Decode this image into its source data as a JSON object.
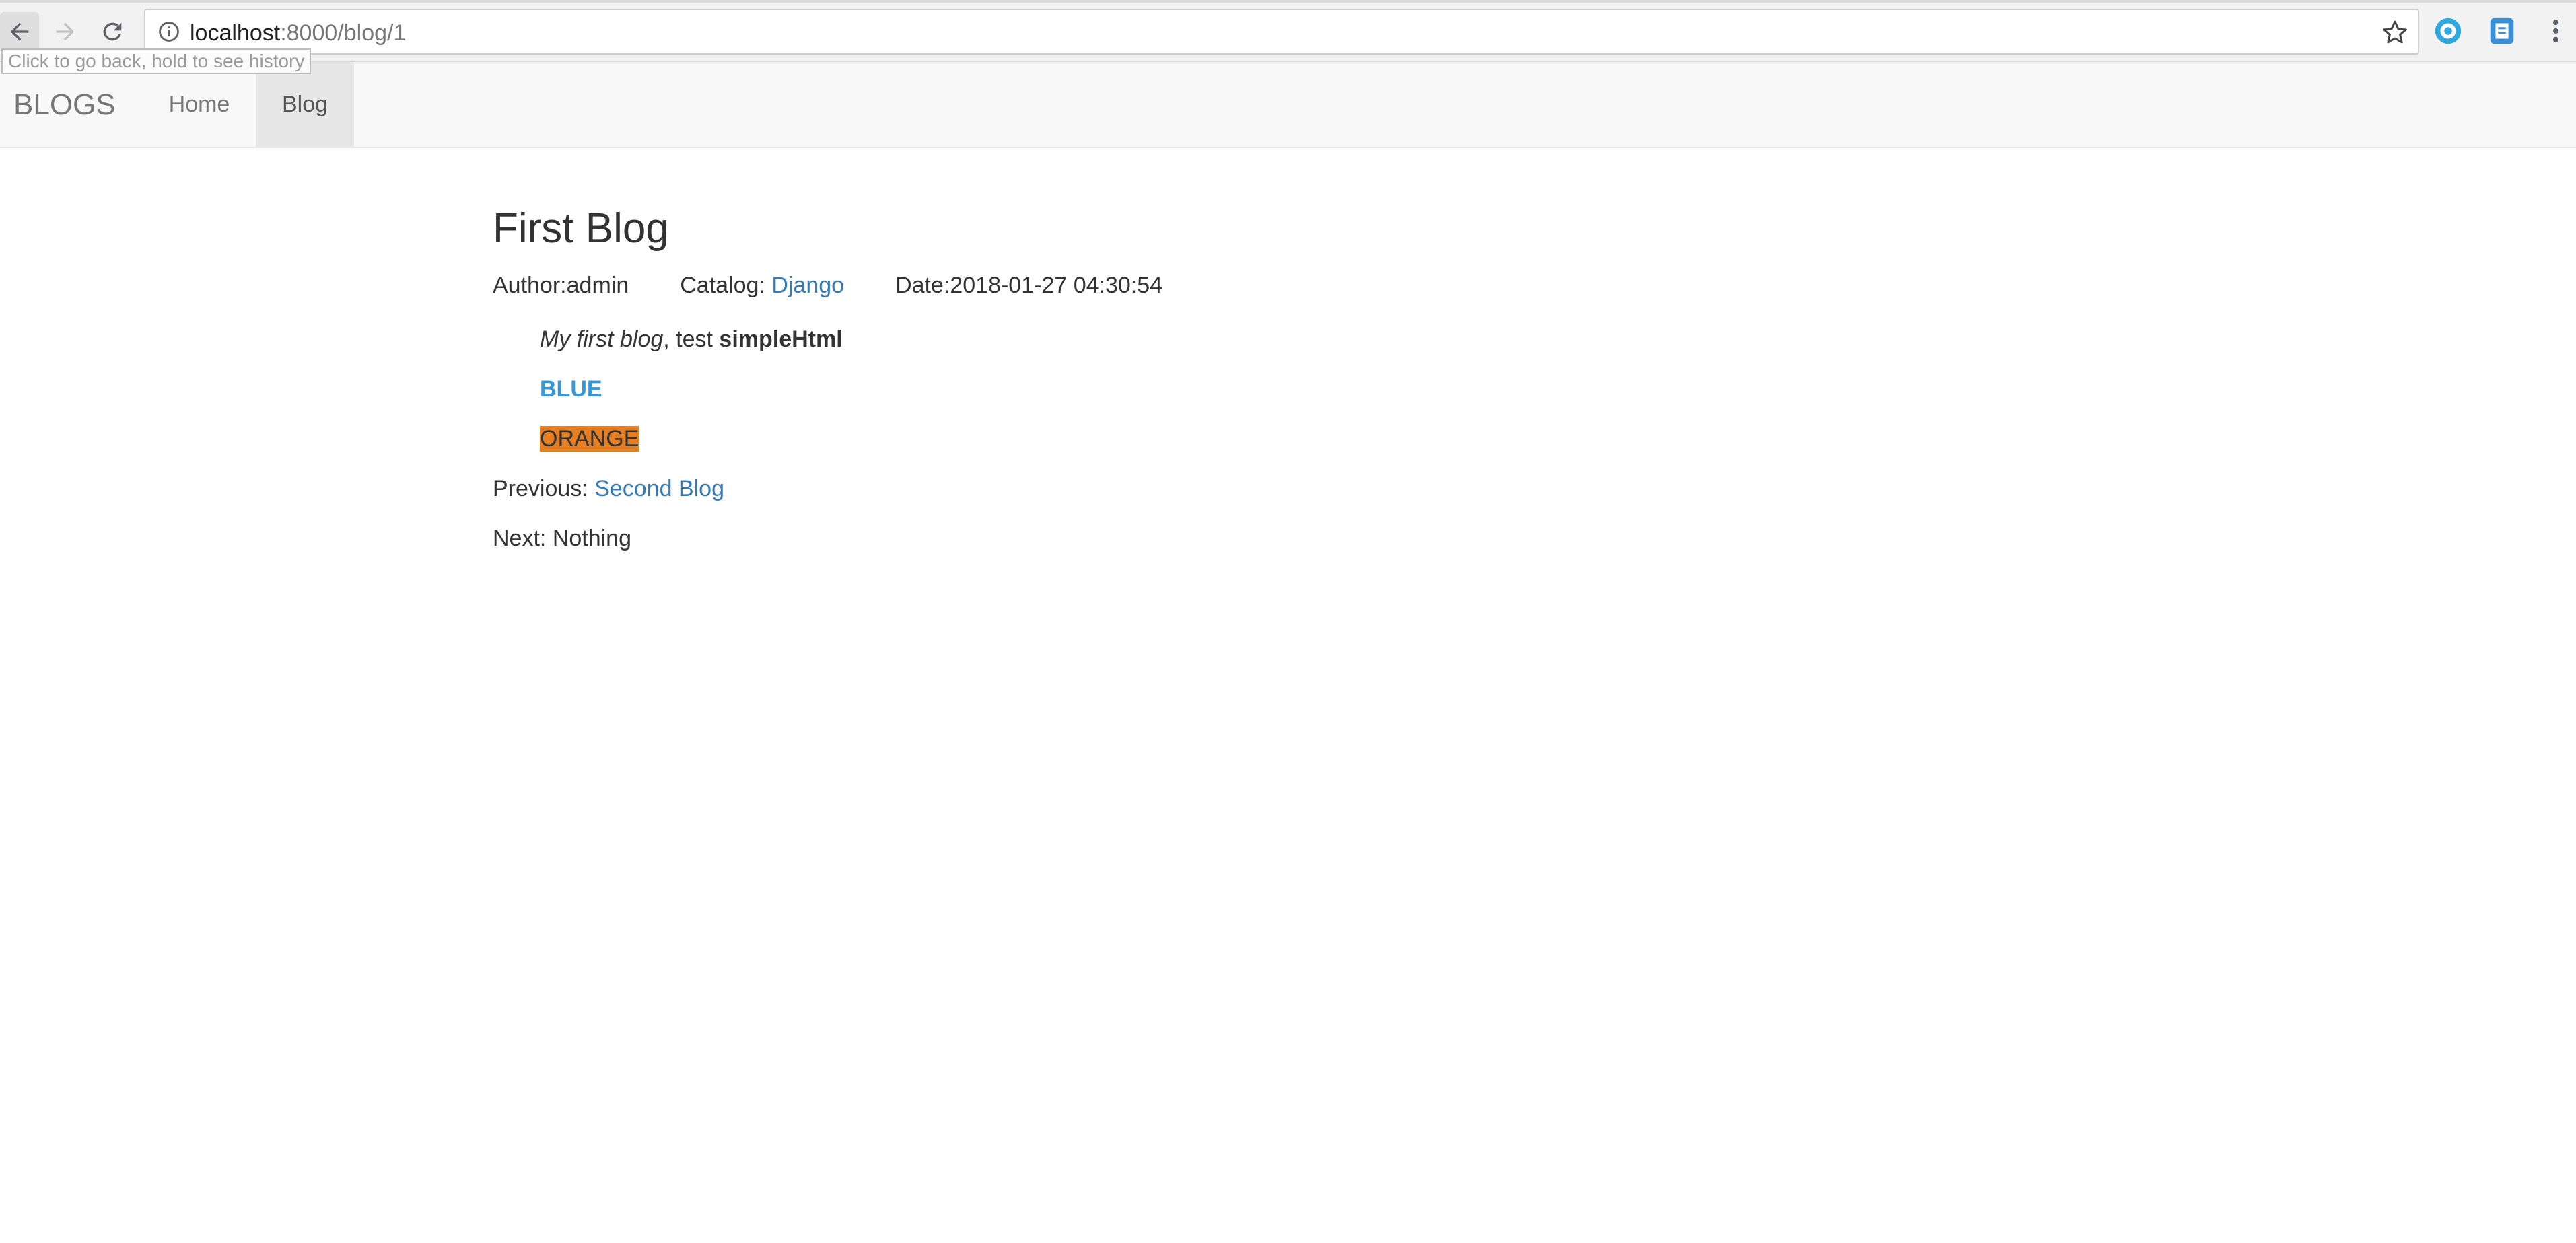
{
  "browser": {
    "url_host": "localhost",
    "url_rest": ":8000/blog/1",
    "tooltip": "Click to go back, hold to see history",
    "colors": {
      "ext1": "#2fa8e0",
      "ext2": "#3a8fd9"
    }
  },
  "navbar": {
    "brand": "BLOGS",
    "items": [
      {
        "label": "Home"
      },
      {
        "label": "Blog"
      }
    ],
    "active": "Blog"
  },
  "post": {
    "title": "First Blog",
    "author_label": "Author:",
    "author": "admin",
    "catalog_label": "Catalog: ",
    "catalog": "Django",
    "date_label": "Date:",
    "date": "2018-01-27 04:30:54",
    "body": {
      "italic": "My first blog",
      "mid": ", test ",
      "bold": "simpleHtml",
      "blue": "BLUE",
      "orange": "ORANGE"
    }
  },
  "pager": {
    "previous_label": "Previous: ",
    "previous_link": "Second Blog",
    "next_label": "Next: ",
    "next_value": "Nothing"
  },
  "colors": {
    "link": "#337ab7",
    "blue_text": "#3498db",
    "orange_bg": "#e67e22",
    "navbar_bg": "#f8f8f8"
  }
}
